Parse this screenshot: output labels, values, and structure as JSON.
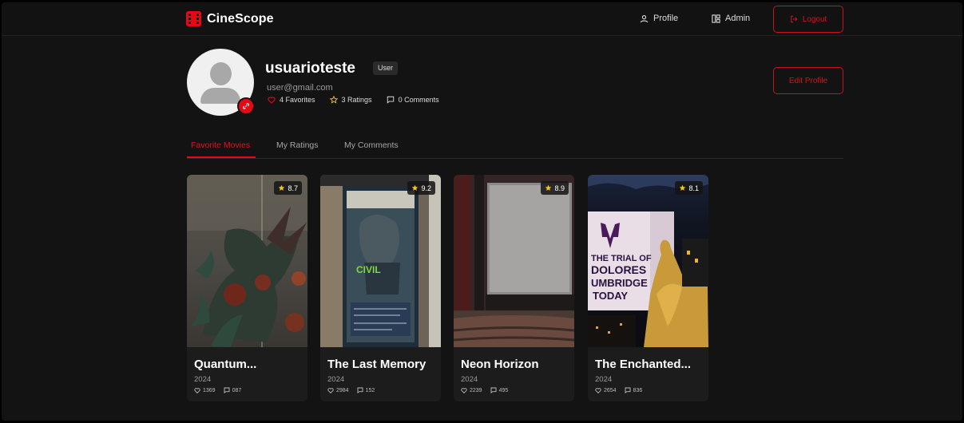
{
  "app": {
    "name": "CineScope"
  },
  "nav": {
    "profile_label": "Profile",
    "admin_label": "Admin",
    "logout_label": "Logout"
  },
  "profile": {
    "username": "usuarioteste",
    "role": "User",
    "email": "user@gmail.com",
    "favorites_label": "4 Favorites",
    "ratings_label": "3 Ratings",
    "comments_label": "0 Comments",
    "edit_label": "Edit Profile"
  },
  "tabs": [
    {
      "label": "Favorite Movies",
      "active": true
    },
    {
      "label": "My Ratings",
      "active": false
    },
    {
      "label": "My Comments",
      "active": false
    }
  ],
  "movies": [
    {
      "title": "Quantum...",
      "year": "2024",
      "rating": "8.7",
      "likes": "1369",
      "comments": "087"
    },
    {
      "title": "The Last Memory",
      "year": "2024",
      "rating": "9.2",
      "likes": "2984",
      "comments": "152"
    },
    {
      "title": "Neon Horizon",
      "year": "2024",
      "rating": "8.9",
      "likes": "2239",
      "comments": "495"
    },
    {
      "title": "The Enchanted...",
      "year": "2024",
      "rating": "8.1",
      "likes": "2654",
      "comments": "836"
    }
  ],
  "posters": {
    "p2_text": "CIVIL",
    "p4_line1": "THE TRIAL OF",
    "p4_line2": "DOLORES",
    "p4_line3": "UMBRIDGE",
    "p4_line4": "TODAY"
  },
  "colors": {
    "accent": "#e50914",
    "background": "#131313",
    "card": "#1c1c1c",
    "star": "#f5c518"
  }
}
